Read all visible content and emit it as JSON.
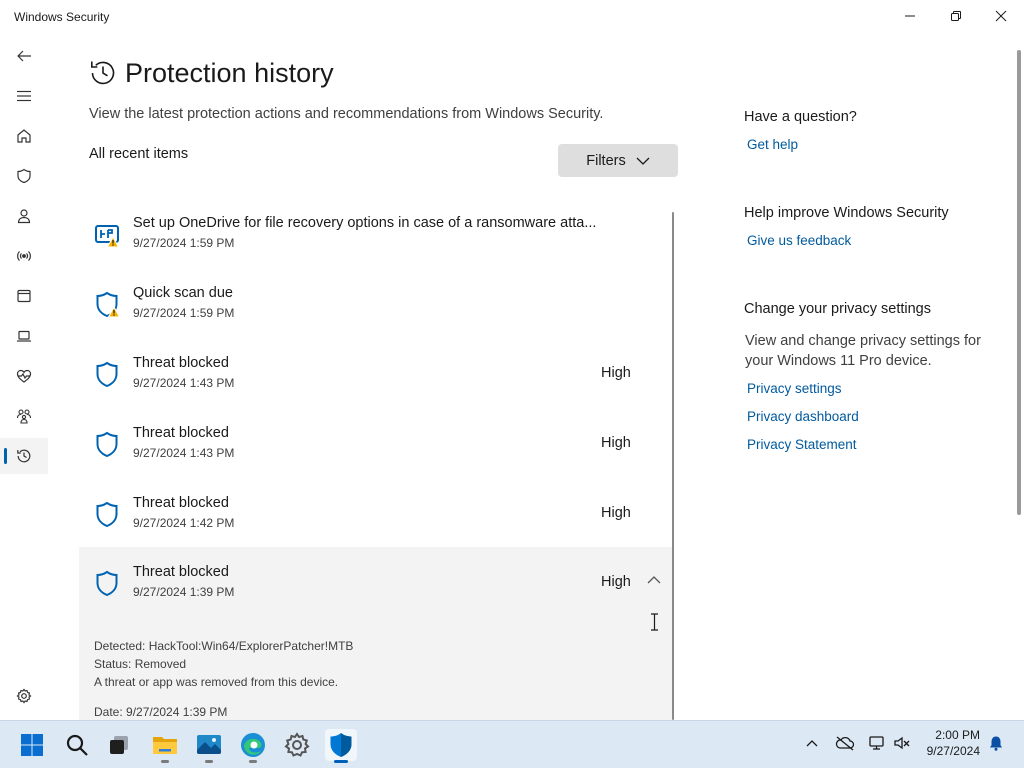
{
  "window": {
    "title": "Windows Security"
  },
  "page": {
    "title": "Protection history",
    "subtitle": "View the latest protection actions and recommendations from Windows Security.",
    "section_label": "All recent items",
    "filters_label": "Filters"
  },
  "nav": {
    "items": [
      {
        "icon": "back-arrow-icon"
      },
      {
        "icon": "hamburger-menu-icon"
      },
      {
        "icon": "home-icon"
      },
      {
        "icon": "shield-icon"
      },
      {
        "icon": "person-icon"
      },
      {
        "icon": "wireless-icon"
      },
      {
        "icon": "browser-window-icon"
      },
      {
        "icon": "laptop-icon"
      },
      {
        "icon": "heart-pulse-icon"
      },
      {
        "icon": "family-icon"
      },
      {
        "icon": "history-icon"
      },
      {
        "icon": "gear-icon"
      }
    ]
  },
  "history": {
    "items": [
      {
        "title": "Set up OneDrive for file recovery options in case of a ransomware atta...",
        "date": "9/27/2024 1:59 PM",
        "severity": "",
        "icon": "onedrive-warning-icon"
      },
      {
        "title": "Quick scan due",
        "date": "9/27/2024 1:59 PM",
        "severity": "",
        "icon": "shield-warning-icon"
      },
      {
        "title": "Threat blocked",
        "date": "9/27/2024 1:43 PM",
        "severity": "High",
        "icon": "shield-icon"
      },
      {
        "title": "Threat blocked",
        "date": "9/27/2024 1:43 PM",
        "severity": "High",
        "icon": "shield-icon"
      },
      {
        "title": "Threat blocked",
        "date": "9/27/2024 1:42 PM",
        "severity": "High",
        "icon": "shield-icon"
      },
      {
        "title": "Threat blocked",
        "date": "9/27/2024 1:39 PM",
        "severity": "High",
        "icon": "shield-icon"
      }
    ],
    "expanded": {
      "detected": "Detected:  HackTool:Win64/ExplorerPatcher!MTB",
      "status": "Status:  Removed",
      "description": "A threat or app was removed from this device.",
      "date": "Date:  9/27/2024 1:39 PM"
    }
  },
  "sidebar": {
    "question_heading": "Have a question?",
    "get_help": "Get help",
    "improve_heading": "Help improve Windows Security",
    "feedback": "Give us feedback",
    "privacy_heading": "Change your privacy settings",
    "privacy_text": "View and change privacy settings for your Windows 11 Pro device.",
    "privacy_settings": "Privacy settings",
    "privacy_dashboard": "Privacy dashboard",
    "privacy_statement": "Privacy Statement"
  },
  "taskbar": {
    "apps": [
      "start-icon",
      "search-icon",
      "task-view-icon",
      "file-explorer-icon",
      "photos-icon",
      "edge-icon",
      "settings-icon",
      "windows-security-icon"
    ],
    "tray": [
      "chevron-up-icon",
      "onedrive-offline-icon",
      "network-icon",
      "volume-muted-icon",
      "notification-bell-icon"
    ],
    "time": "2:00 PM",
    "date": "9/27/2024"
  },
  "colors": {
    "accent": "#0063b1",
    "link": "#005a9e",
    "warning": "#f7b500"
  }
}
